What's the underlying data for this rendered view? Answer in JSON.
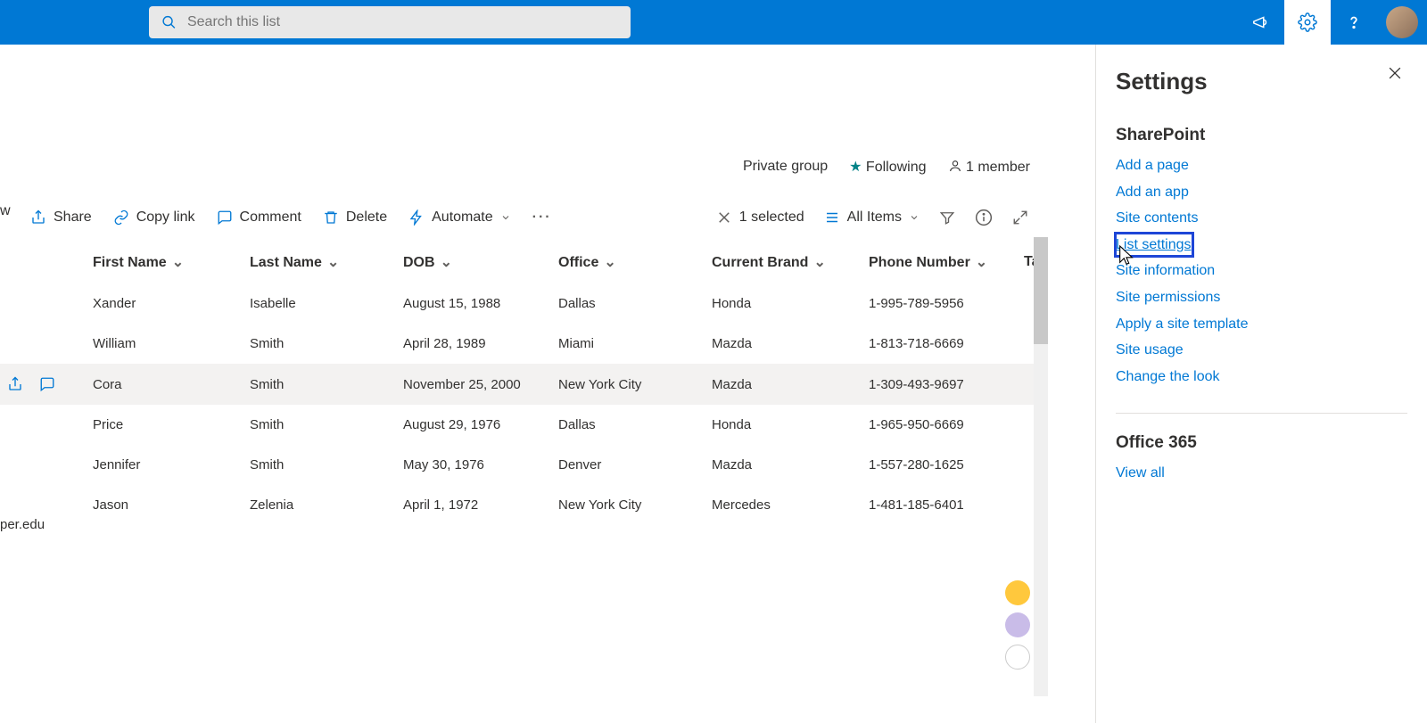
{
  "search": {
    "placeholder": "Search this list"
  },
  "headerMeta": {
    "group": "Private group",
    "following": "Following",
    "members": "1 member"
  },
  "cmdbar": {
    "new_trunc": "w",
    "share": "Share",
    "copylink": "Copy link",
    "comment": "Comment",
    "delete": "Delete",
    "automate": "Automate",
    "selected": "1 selected",
    "view": "All Items"
  },
  "columns": [
    "First Name",
    "Last Name",
    "DOB",
    "Office",
    "Current Brand",
    "Phone Number",
    "Ta"
  ],
  "leftedge_trunc": "per.edu",
  "rows": [
    {
      "first": "Xander",
      "last": "Isabelle",
      "dob": "August 15, 1988",
      "office": "Dallas",
      "brand": "Honda",
      "phone": "1-995-789-5956",
      "sel": false
    },
    {
      "first": "William",
      "last": "Smith",
      "dob": "April 28, 1989",
      "office": "Miami",
      "brand": "Mazda",
      "phone": "1-813-718-6669",
      "sel": false
    },
    {
      "first": "Cora",
      "last": "Smith",
      "dob": "November 25, 2000",
      "office": "New York City",
      "brand": "Mazda",
      "phone": "1-309-493-9697",
      "sel": true
    },
    {
      "first": "Price",
      "last": "Smith",
      "dob": "August 29, 1976",
      "office": "Dallas",
      "brand": "Honda",
      "phone": "1-965-950-6669",
      "sel": false
    },
    {
      "first": "Jennifer",
      "last": "Smith",
      "dob": "May 30, 1976",
      "office": "Denver",
      "brand": "Mazda",
      "phone": "1-557-280-1625",
      "sel": false
    },
    {
      "first": "Jason",
      "last": "Zelenia",
      "dob": "April 1, 1972",
      "office": "New York City",
      "brand": "Mercedes",
      "phone": "1-481-185-6401",
      "sel": false
    }
  ],
  "dots": [
    "#ffc83d",
    "#bdb0e6",
    "#ffffff"
  ],
  "panel": {
    "title": "Settings",
    "section1": "SharePoint",
    "links1": [
      "Add a page",
      "Add an app",
      "Site contents",
      "List settings",
      "Site information",
      "Site permissions",
      "Apply a site template",
      "Site usage",
      "Change the look"
    ],
    "highlightIndex": 3,
    "section2": "Office 365",
    "links2": [
      "View all"
    ]
  }
}
